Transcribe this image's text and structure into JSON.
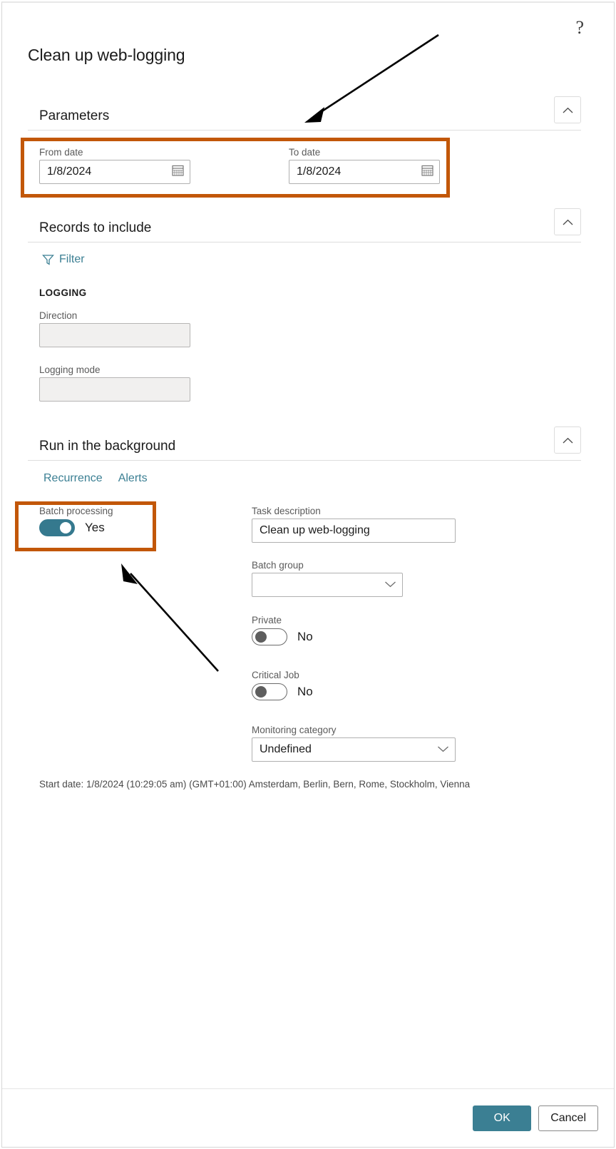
{
  "dialog": {
    "title": "Clean up web-logging",
    "help_icon": "?"
  },
  "sections": {
    "parameters": {
      "title": "Parameters",
      "collapse_icon": "chevron-up",
      "from_date": {
        "label": "From date",
        "value": "1/8/2024",
        "icon": "calendar-icon"
      },
      "to_date": {
        "label": "To date",
        "value": "1/8/2024",
        "icon": "calendar-icon"
      }
    },
    "records": {
      "title": "Records to include",
      "collapse_icon": "chevron-up",
      "filter_label": "Filter",
      "filter_icon": "funnel-icon",
      "group_header": "LOGGING",
      "fields": [
        {
          "label": "Direction",
          "value": ""
        },
        {
          "label": "Logging mode",
          "value": ""
        }
      ]
    },
    "background": {
      "title": "Run in the background",
      "collapse_icon": "chevron-up",
      "tabs": [
        {
          "label": "Recurrence"
        },
        {
          "label": "Alerts"
        }
      ],
      "batch_processing": {
        "label": "Batch processing",
        "value": "Yes",
        "state": "on"
      },
      "task_description": {
        "label": "Task description",
        "value": "Clean up web-logging"
      },
      "batch_group": {
        "label": "Batch group",
        "value": "",
        "icon": "chevron-down-icon"
      },
      "private": {
        "label": "Private",
        "value": "No",
        "state": "off"
      },
      "critical_job": {
        "label": "Critical Job",
        "value": "No",
        "state": "off"
      },
      "monitoring_category": {
        "label": "Monitoring category",
        "value": "Undefined",
        "icon": "chevron-down-icon"
      },
      "start_date_note": "Start date: 1/8/2024 (10:29:05 am) (GMT+01:00) Amsterdam, Berlin, Bern, Rome, Stockholm, Vienna"
    }
  },
  "footer": {
    "ok_label": "OK",
    "cancel_label": "Cancel"
  },
  "colors": {
    "accent_teal": "#3b7f93",
    "highlight_orange": "#c25708",
    "toggle_on": "#35798e",
    "link_blue": "#3b7f93"
  }
}
